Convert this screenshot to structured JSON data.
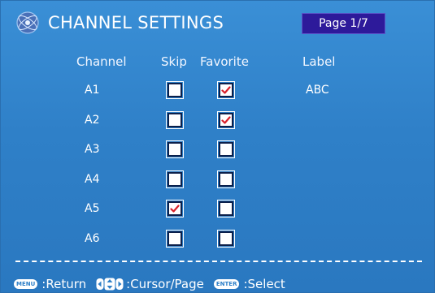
{
  "header": {
    "title": "CHANNEL SETTINGS",
    "page": "Page 1/7"
  },
  "columns": {
    "channel": "Channel",
    "skip": "Skip",
    "favorite": "Favorite",
    "label": "Label"
  },
  "rows": [
    {
      "channel": "A1",
      "skip": false,
      "favorite": true,
      "label": "ABC"
    },
    {
      "channel": "A2",
      "skip": false,
      "favorite": true,
      "label": ""
    },
    {
      "channel": "A3",
      "skip": false,
      "favorite": false,
      "label": ""
    },
    {
      "channel": "A4",
      "skip": false,
      "favorite": false,
      "label": ""
    },
    {
      "channel": "A5",
      "skip": true,
      "favorite": false,
      "label": ""
    },
    {
      "channel": "A6",
      "skip": false,
      "favorite": false,
      "label": ""
    }
  ],
  "footer": {
    "menu_key": "MENU",
    "return_label": ":Return",
    "cursor_label": ":Cursor/Page",
    "enter_key": "ENTER",
    "select_label": ":Select"
  },
  "colors": {
    "background": "#2f80c8",
    "page_badge": "#2d1a9a",
    "check_mark": "#d8202a"
  },
  "icons": {
    "logo": "globe-logo-icon",
    "check": "check-mark-icon",
    "nav": "directional-pad-icon"
  }
}
